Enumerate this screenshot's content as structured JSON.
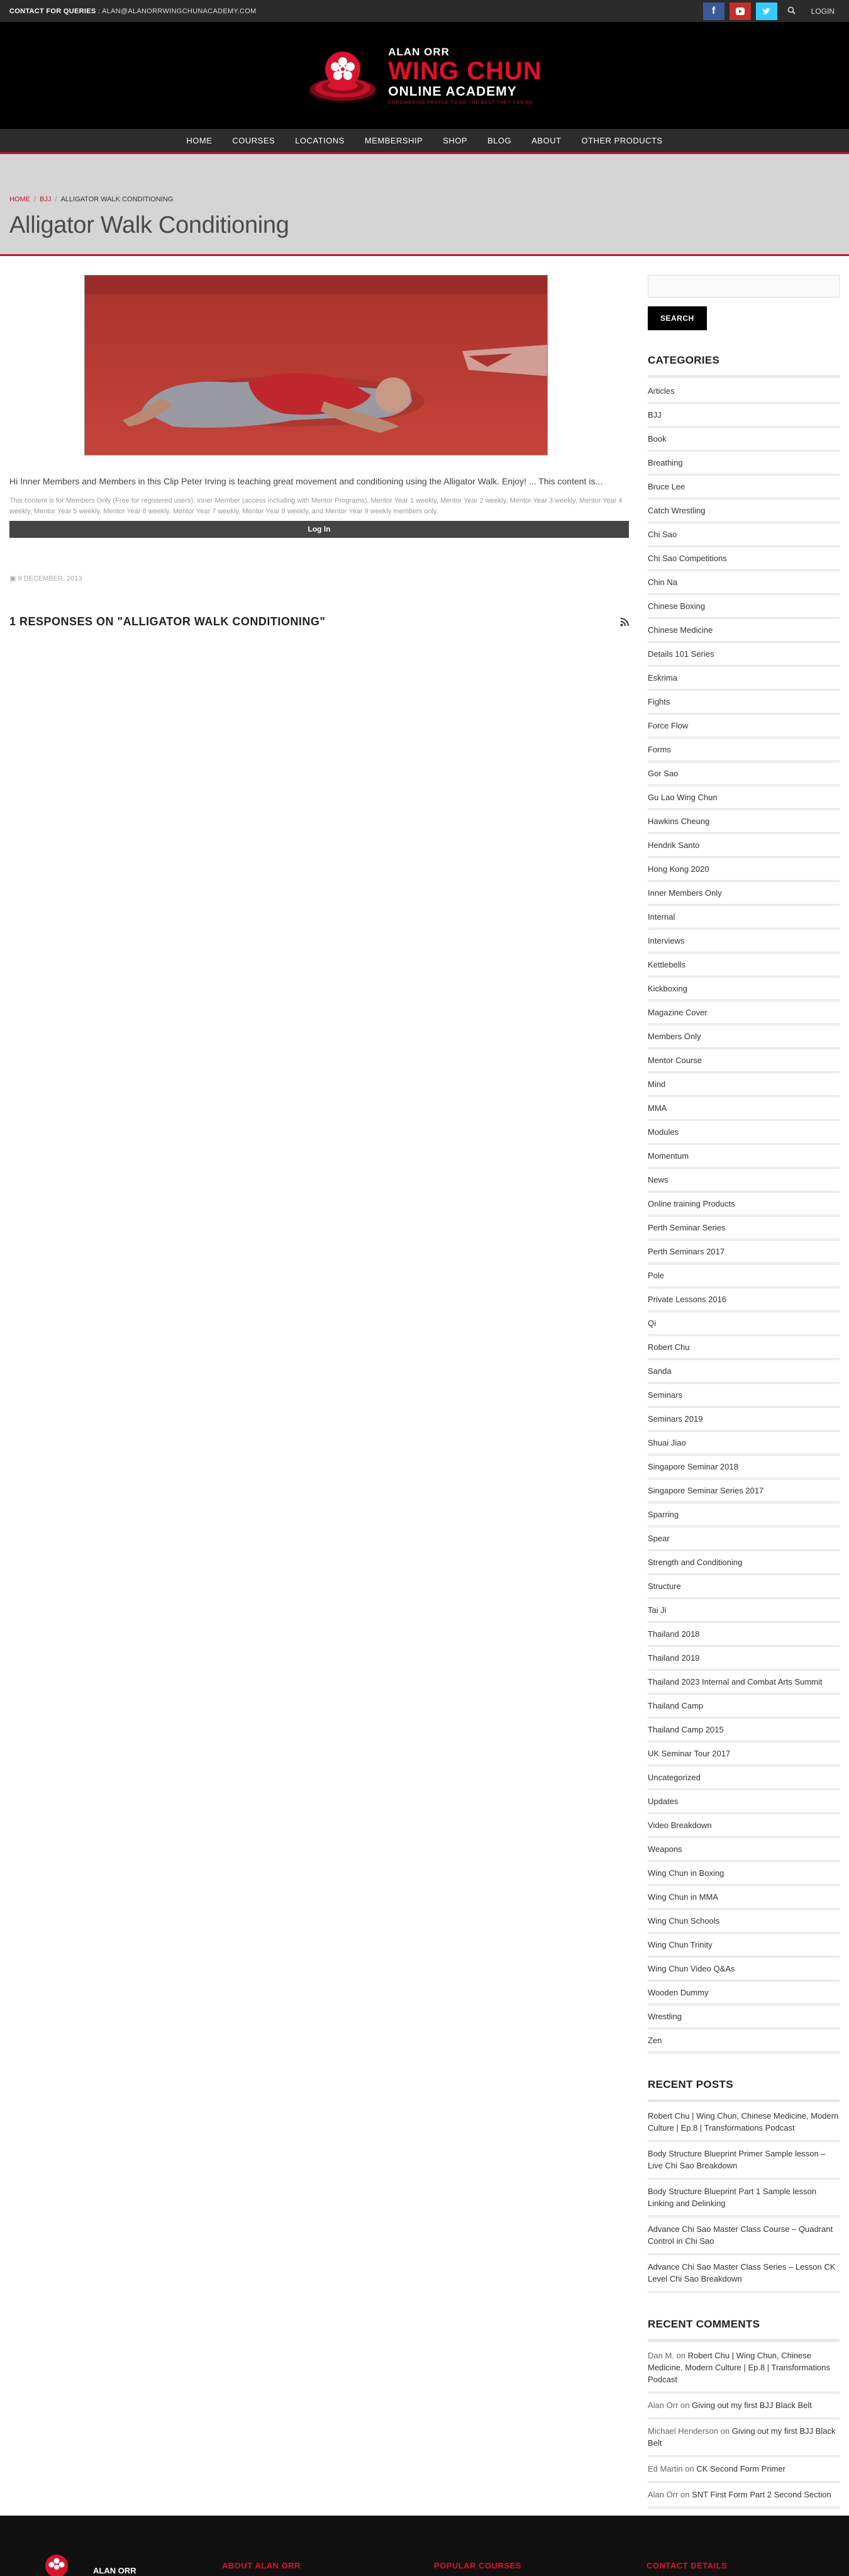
{
  "topbar": {
    "contact_label": "CONTACT FOR QUERIES",
    "contact_email": "ALAN@ALANORRWINGCHUNACADEMY.COM",
    "login": "LOGIN"
  },
  "logo": {
    "line1": "ALAN ORR",
    "line2": "WING CHUN",
    "line3": "ONLINE ACADEMY",
    "tagline": "EMPOWERING PEOPLE TO BE THE BEST THEY CAN BE"
  },
  "nav": [
    "HOME",
    "COURSES",
    "LOCATIONS",
    "MEMBERSHIP",
    "SHOP",
    "BLOG",
    "ABOUT",
    "OTHER PRODUCTS"
  ],
  "breadcrumb": {
    "home": "HOME",
    "cat": "BJJ",
    "current": "ALLIGATOR WALK CONDITIONING"
  },
  "page_title": "Alligator Walk Conditioning",
  "post": {
    "intro": "Hi Inner Members and Members in this Clip Peter Irving is teaching great movement and conditioning using the Alligator Walk. Enjoy!  ... This content is...",
    "members_note": "This content is for Members Only (Free for registered users), Inner Member (access including with Mentor Programs), Mentor Year 1 weekly, Mentor Year 2 weekly, Mentor Year 3 weekly, Mentor Year 4 weekly, Mentor Year 5 weekly, Mentor Year 6 weekly, Mentor Year 7 weekly, Mentor Year 8 weekly, and Mentor Year 9 weekly members only.",
    "login_button": "Log In",
    "date": "9 DECEMBER, 2013",
    "responses_title": "1 RESPONSES ON \"ALLIGATOR WALK CONDITIONING\""
  },
  "sidebar": {
    "search_button": "SEARCH",
    "categories_title": "CATEGORIES",
    "categories": [
      "Articles",
      "BJJ",
      "Book",
      "Breathing",
      "Bruce Lee",
      "Catch Wrestling",
      "Chi Sao",
      "Chi Sao Competitions",
      "Chin Na",
      "Chinese Boxing",
      "Chinese Medicine",
      "Details 101 Series",
      "Eskrima",
      "Fights",
      "Force Flow",
      "Forms",
      "Gor Sao",
      "Gu Lao Wing Chun",
      "Hawkins Cheung",
      "Hendrik Santo",
      "Hong Kong 2020",
      "Inner Members Only",
      "Internal",
      "Interviews",
      "Kettlebells",
      "Kickboxing",
      "Magazine Cover",
      "Members Only",
      "Mentor Course",
      "Mind",
      "MMA",
      "Modules",
      "Momentum",
      "News",
      "Online training Products",
      "Perth Seminar Series",
      "Perth Seminars 2017",
      "Pole",
      "Private Lessons 2016",
      "Qi",
      "Robert Chu",
      "Sanda",
      "Seminars",
      "Seminars 2019",
      "Shuai Jiao",
      "Singapore Seminar 2018",
      "Singapore Seminar Series 2017",
      "Sparring",
      "Spear",
      "Strength and Conditioning",
      "Structure",
      "Tai Ji",
      "Thailand 2018",
      "Thailand 2019",
      "Thailand 2023 Internal and Combat Arts Summit",
      "Thailand Camp",
      "Thailand Camp 2015",
      "UK Seminar Tour 2017",
      "Uncategorized",
      "Updates",
      "Video Breakdown",
      "Weapons",
      "Wing Chun in Boxing",
      "Wing Chun in MMA",
      "Wing Chun Schools",
      "Wing Chun Trinity",
      "Wing Chun Video Q&As",
      "Wooden Dummy",
      "Wrestling",
      "Zen"
    ],
    "recent_posts_title": "RECENT POSTS",
    "recent_posts": [
      "Robert Chu | Wing Chun, Chinese Medicine, Modern Culture | Ep.8 | Transformations Podcast",
      "Body Structure Blueprint Primer Sample lesson – Live Chi Sao Breakdown",
      "Body Structure Blueprint Part 1 Sample lesson Linking and Delinking",
      "Advance Chi Sao Master Class Course – Quadrant Control in Chi Sao",
      "Advance Chi Sao Master Class Series – Lesson CK Level Chi Sao Breakdown"
    ],
    "recent_comments_title": "RECENT COMMENTS",
    "recent_comments": [
      {
        "author": "Dan M.",
        "on": "on",
        "post": "Robert Chu | Wing Chun, Chinese Medicine, Modern Culture | Ep.8 | Transformations Podcast"
      },
      {
        "author": "Alan Orr",
        "on": "on",
        "post": "Giving out my first BJJ Black Belt"
      },
      {
        "author": "Michael Henderson",
        "on": "on",
        "post": "Giving out my first BJJ Black Belt"
      },
      {
        "author": "Ed Martin",
        "on": "on",
        "post": "CK Second Form Primer"
      },
      {
        "author": "Alan Orr",
        "on": "on",
        "post": "SNT First Form Part 2 Second Section"
      }
    ]
  },
  "footer": {
    "brand": "ALAN ORR",
    "col1": "ABOUT ALAN ORR",
    "col2": "POPULAR COURSES",
    "col3": "CONTACT DETAILS"
  }
}
